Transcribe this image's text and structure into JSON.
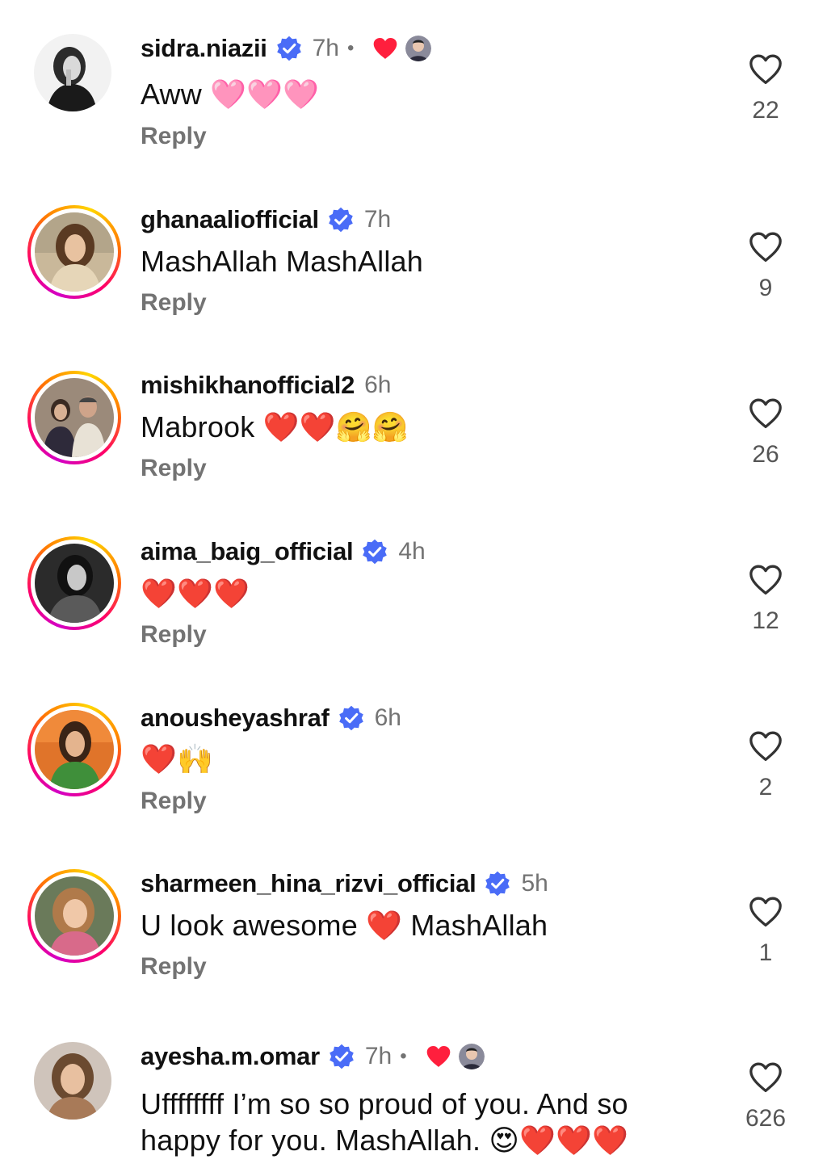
{
  "colors": {
    "verified": "#3897f0",
    "heart": "#ff1f3d",
    "secondary_text": "#737373",
    "story_ring": [
      "#d300c5",
      "#ff0069",
      "#ff7a00",
      "#ffd600"
    ]
  },
  "comments": [
    {
      "username": "sidra.niazii",
      "verified": true,
      "time": "7h",
      "separator": "•",
      "liked_by_author": true,
      "text": "Aww 🩷🩷🩷",
      "reply_label": "Reply",
      "likes": "22",
      "story_ring": false
    },
    {
      "username": "ghanaaliofficial",
      "verified": true,
      "time": "7h",
      "liked_by_author": false,
      "text": "MashAllah MashAllah",
      "reply_label": "Reply",
      "likes": "9",
      "story_ring": true
    },
    {
      "username": "mishikhanofficial2",
      "verified": false,
      "time": "6h",
      "liked_by_author": false,
      "text": "Mabrook ❤️❤️🤗🤗",
      "reply_label": "Reply",
      "likes": "26",
      "story_ring": true
    },
    {
      "username": "aima_baig_official",
      "verified": true,
      "time": "4h",
      "liked_by_author": false,
      "text": "❤️❤️❤️",
      "reply_label": "Reply",
      "likes": "12",
      "story_ring": true
    },
    {
      "username": "anousheyashraf",
      "verified": true,
      "time": "6h",
      "liked_by_author": false,
      "text": "❤️🙌",
      "reply_label": "Reply",
      "likes": "2",
      "story_ring": true
    },
    {
      "username": "sharmeen_hina_rizvi_official",
      "verified": true,
      "time": "5h",
      "liked_by_author": false,
      "text": "U look awesome ❤️ MashAllah",
      "reply_label": "Reply",
      "likes": "1",
      "story_ring": true
    },
    {
      "username": "ayesha.m.omar",
      "verified": true,
      "time": "7h",
      "separator": "•",
      "liked_by_author": true,
      "text_line1": "Uffffffff I’m so so proud of you. And so",
      "text_line2": "happy for you. MashAllah. 😍❤️❤️❤️",
      "likes": "626",
      "story_ring": false
    }
  ]
}
